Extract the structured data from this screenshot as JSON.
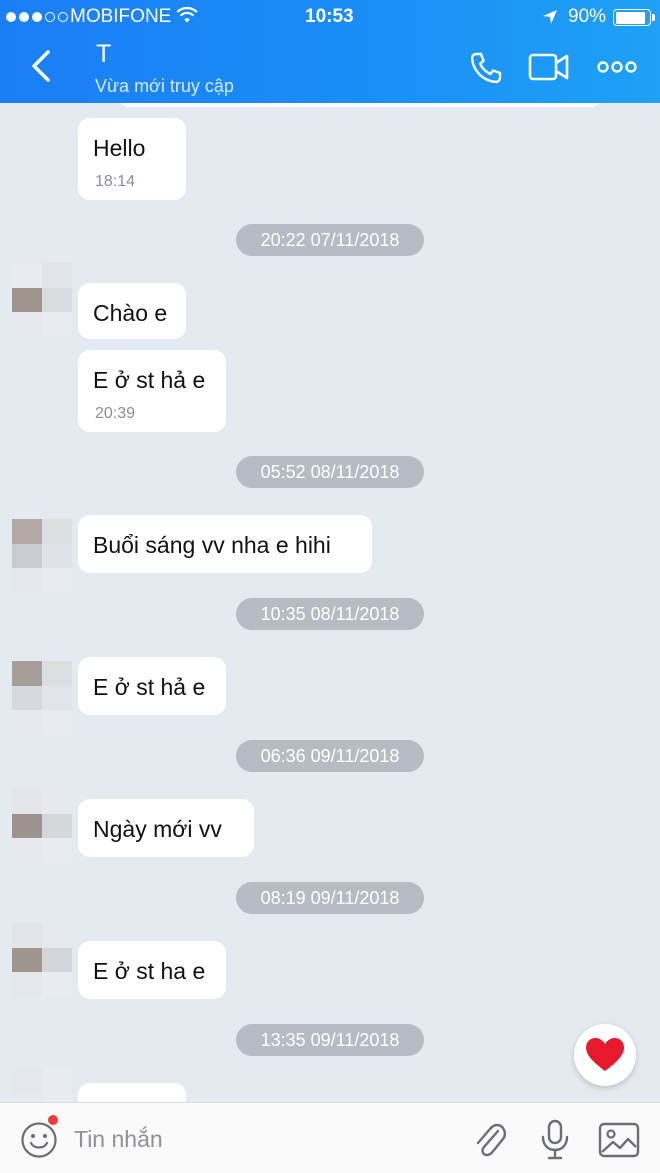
{
  "status_bar": {
    "carrier": "MOBIFONE",
    "time": "10:53",
    "battery": "90%",
    "battery_level": 0.9
  },
  "header": {
    "title": "T",
    "subtitle": "Vừa mới truy cập",
    "icons": [
      "back-chevron-icon",
      "phone-icon",
      "video-camera-icon",
      "more-dots-icon"
    ],
    "accent_color": "#1a8cf7"
  },
  "messages": [
    {
      "type": "message",
      "text": "Hello",
      "time": "18:14"
    },
    {
      "type": "date",
      "text": "20:22 07/11/2018"
    },
    {
      "type": "message",
      "text": "Chào e"
    },
    {
      "type": "message",
      "text": "E ở st hả e",
      "time": "20:39"
    },
    {
      "type": "date",
      "text": "05:52 08/11/2018"
    },
    {
      "type": "message",
      "text": "Buổi sáng vv nha e hihi"
    },
    {
      "type": "date",
      "text": "10:35 08/11/2018"
    },
    {
      "type": "message",
      "text": "E ở st hả e"
    },
    {
      "type": "date",
      "text": "06:36 09/11/2018"
    },
    {
      "type": "message",
      "text": "Ngày mới vv"
    },
    {
      "type": "date",
      "text": "08:19 09/11/2018"
    },
    {
      "type": "message",
      "text": "E ở st ha e"
    },
    {
      "type": "date",
      "text": "13:35 09/11/2018"
    }
  ],
  "input_bar": {
    "placeholder": "Tin nhắn",
    "icons": [
      "emoji-icon",
      "paperclip-icon",
      "microphone-icon",
      "image-icon"
    ],
    "notification_dot_color": "#f03a3a"
  },
  "floating": {
    "icon": "heart-icon",
    "color": "#e8192c"
  }
}
